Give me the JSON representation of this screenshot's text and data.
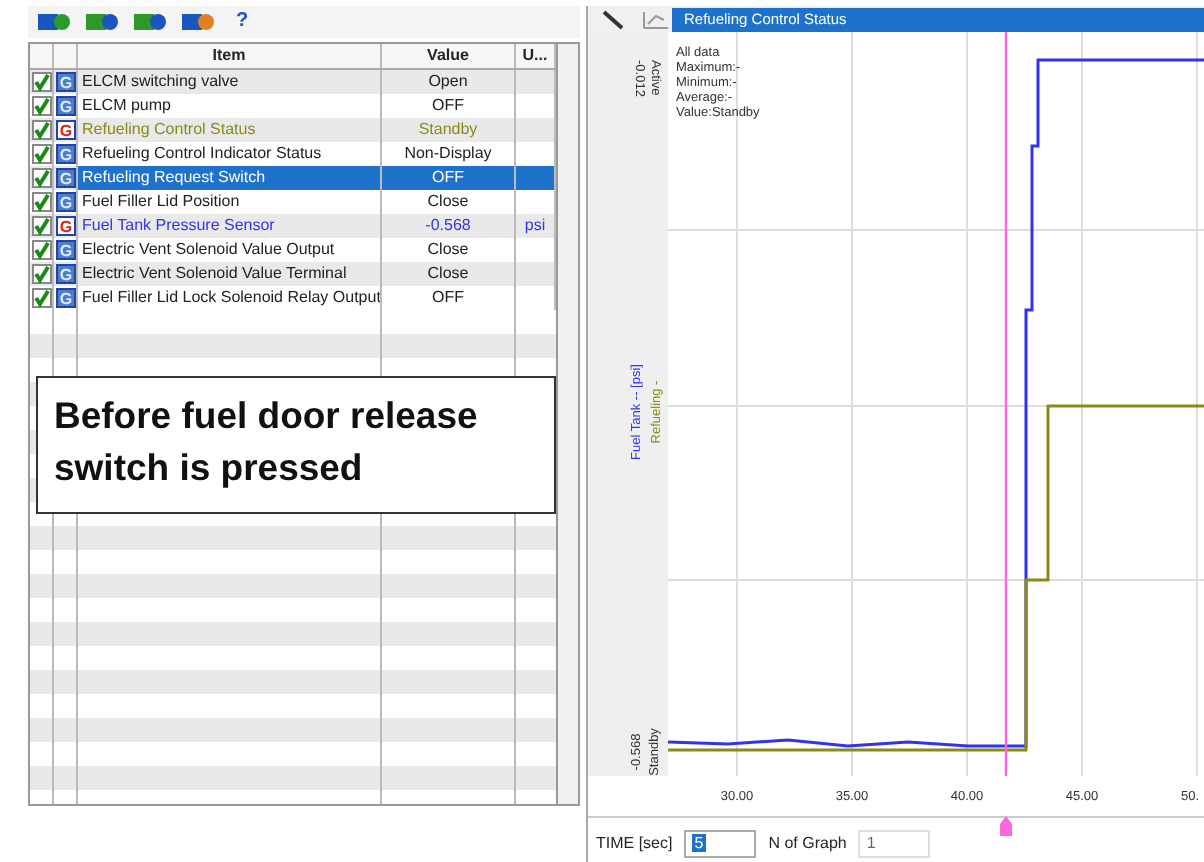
{
  "left_toolbar": {
    "help_label": "?"
  },
  "table": {
    "columns": [
      {
        "label": "Item"
      },
      {
        "label": "Value"
      },
      {
        "label": "U..."
      }
    ],
    "rows": [
      {
        "item": "ELCM switching valve",
        "value": "Open",
        "unit": "",
        "checked": true,
        "graph_label": "G",
        "graphed": false,
        "selected": false
      },
      {
        "item": "ELCM pump",
        "value": "OFF",
        "unit": "",
        "checked": true,
        "graph_label": "G",
        "graphed": false,
        "selected": false
      },
      {
        "item": "Refueling Control Status",
        "value": "Standby",
        "unit": "",
        "checked": true,
        "graph_label": "G",
        "graphed": true,
        "selected": false,
        "color": "#8a8a1a"
      },
      {
        "item": "Refueling Control Indicator Status",
        "value": "Non-Display",
        "unit": "",
        "checked": true,
        "graph_label": "G",
        "graphed": false,
        "selected": false
      },
      {
        "item": "Refueling Request Switch",
        "value": "OFF",
        "unit": "",
        "checked": true,
        "graph_label": "G",
        "graphed": false,
        "selected": true
      },
      {
        "item": "Fuel Filler Lid Position",
        "value": "Close",
        "unit": "",
        "checked": true,
        "graph_label": "G",
        "graphed": false,
        "selected": false
      },
      {
        "item": "Fuel Tank Pressure Sensor",
        "value": "-0.568",
        "unit": "psi",
        "checked": true,
        "graph_label": "G",
        "graphed": true,
        "selected": false,
        "color": "#3333ee"
      },
      {
        "item": "Electric Vent Solenoid Value Output",
        "value": "Close",
        "unit": "",
        "checked": true,
        "graph_label": "G",
        "graphed": false,
        "selected": false
      },
      {
        "item": "Electric Vent Solenoid Value Terminal",
        "value": "Close",
        "unit": "",
        "checked": true,
        "graph_label": "G",
        "graphed": false,
        "selected": false
      },
      {
        "item": "Fuel Filler Lid Lock Solenoid Relay Output",
        "value": "OFF",
        "unit": "",
        "checked": true,
        "graph_label": "G",
        "graphed": false,
        "selected": false
      }
    ]
  },
  "callout": {
    "text": "Before fuel door release switch is pressed"
  },
  "graph": {
    "tab_title": "Refueling Control Status",
    "legend": [
      "All data",
      "Maximum:-",
      "Minimum:-",
      "Average:-",
      "Value:Standby"
    ],
    "axis_top": [
      {
        "text": "-0.012"
      },
      {
        "text": "Active"
      }
    ],
    "axis_middle": [
      {
        "text": "Fuel Tank -- [psi]",
        "color": "#3333ee"
      },
      {
        "text": "Refueling -",
        "color": "#8a8a1a"
      }
    ],
    "axis_bottom": [
      {
        "text": "-0.568"
      },
      {
        "text": "Standby"
      }
    ],
    "time_ticks": [
      "30.00",
      "35.00",
      "40.00",
      "45.00",
      "50."
    ],
    "time_label": "TIME [sec]",
    "time_value": "5",
    "ngraph_label": "N of Graph",
    "ngraph_value": "1"
  }
}
